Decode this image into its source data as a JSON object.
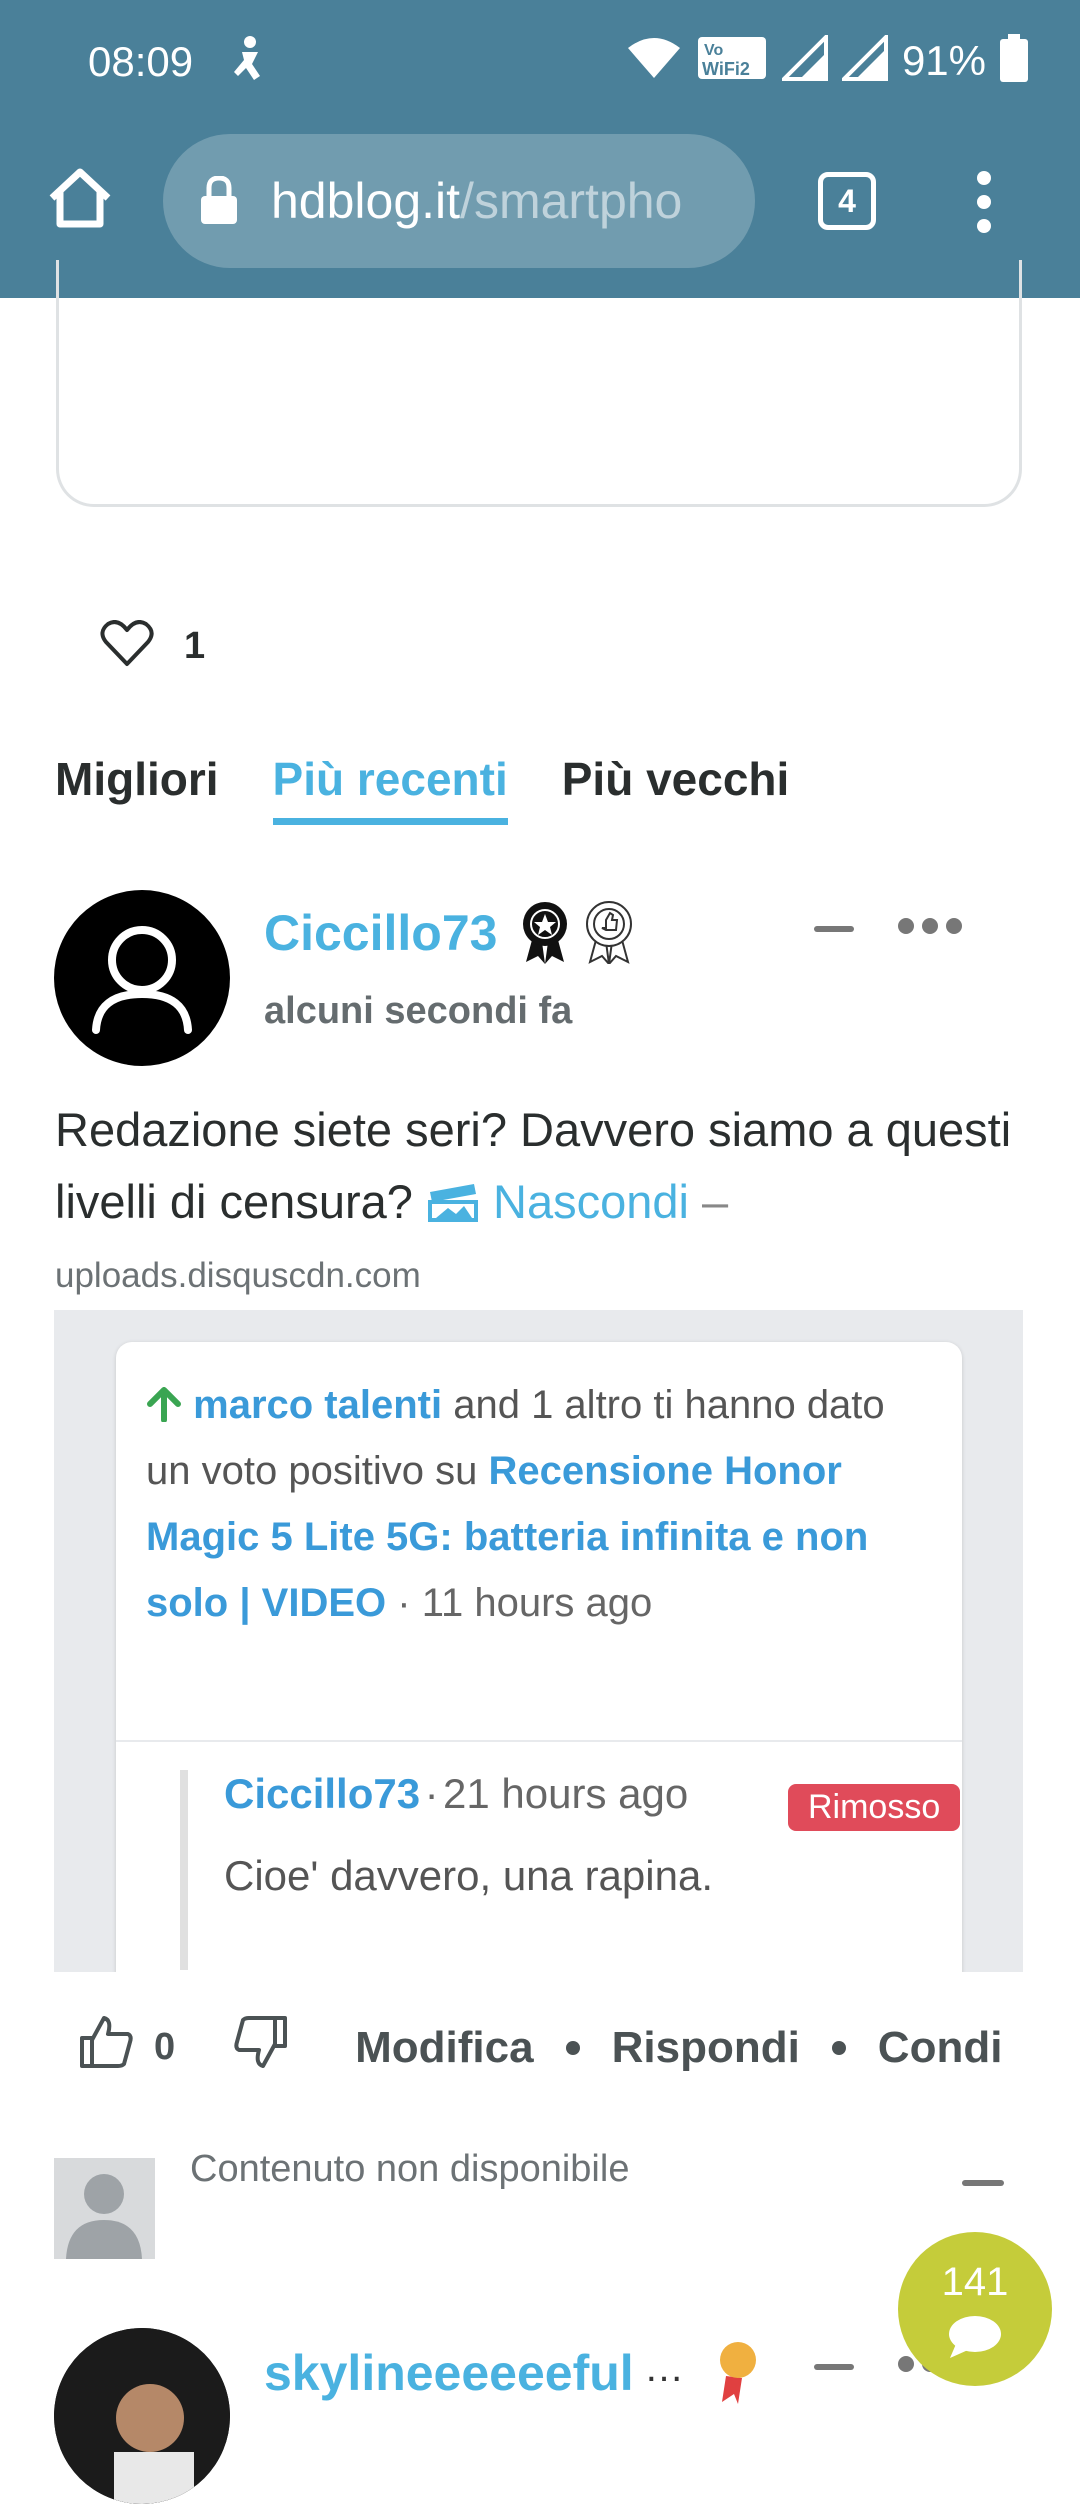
{
  "status_bar": {
    "time": "08:09",
    "battery": "91%",
    "vowifi": "Vo WiFi 2",
    "icons": [
      "accessibility-icon",
      "wifi-icon",
      "signal-icon",
      "signal-icon",
      "battery-icon"
    ]
  },
  "browser": {
    "url_domain": "hdblog.it",
    "url_path": "/smartpho",
    "tab_count": "4",
    "toolbar_color": "#4a8099"
  },
  "likes": {
    "count": "1"
  },
  "sort_tabs": [
    {
      "label": "Migliori",
      "active": false
    },
    {
      "label": "Più recenti",
      "active": true
    },
    {
      "label": "Più vecchi",
      "active": false
    }
  ],
  "comment": {
    "author": "Ciccillo73",
    "time": "alcuni secondi fa",
    "text": "Redazione siete seri? Davvero siamo a questi livelli di censura?",
    "hide_label": "Nascondi",
    "dash": "–",
    "domain": "uploads.disquscdn.com",
    "image": {
      "voters": "marco talenti",
      "voted_text": "and 1 altro ti hanno dato un voto positivo su",
      "article": "Recensione Honor Magic 5 Lite 5G: batteria infinita e non solo | VIDEO",
      "sep": "·",
      "age": "11 hours ago",
      "quote_author": "Ciccillo73",
      "quote_time": "21 hours ago",
      "quote_badge": "Rimosso",
      "quote_text": "Cioe' davvero, una rapina."
    },
    "upvotes": "0",
    "actions": [
      "Modifica",
      "Rispondi",
      "Condi"
    ]
  },
  "unavailable": {
    "text": "Contenuto non disponibile"
  },
  "fab": {
    "count": "141",
    "color": "#c5cc3a"
  },
  "next_comment": {
    "author": "skylineeeeeeful",
    "ellipsis": "…"
  },
  "accent_color": "#4ab2e0"
}
